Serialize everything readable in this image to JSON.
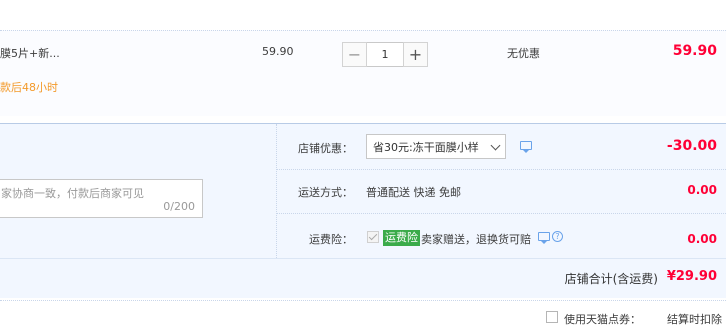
{
  "item": {
    "title_fragment": "膜5片+新...",
    "shipping_note": "款后48小时",
    "unit_price": "59.90",
    "quantity": "1",
    "qty_minus": "−",
    "qty_plus": "+",
    "promotion": "无优惠",
    "subtotal": "59.90"
  },
  "memo": {
    "placeholder": "家协商一致，付款后商家可见",
    "counter": "0/200"
  },
  "shop_discount": {
    "label": "店铺优惠：",
    "selected_option": "省30元:冻干面膜小样",
    "amount": "-30.00"
  },
  "shipping": {
    "label": "运送方式：",
    "value": "普通配送 快递 免邮",
    "amount": "0.00"
  },
  "freight_insurance": {
    "label": "运费险：",
    "badge": "运费险",
    "description": "卖家赠送，退换货可赔",
    "amount": "0.00"
  },
  "shop_total": {
    "label": "店铺合计(含运费)",
    "amount": "¥29.90"
  },
  "tmall_points": {
    "label": "使用天猫点券：",
    "note": "结算时扣除"
  },
  "colors": {
    "price_red": "#ff0036",
    "accent_orange": "#f39a2b",
    "badge_green": "#3bab4a",
    "panel_blue": "#f2f7ff",
    "link_blue": "#6aa3ea"
  },
  "icons": [
    "chat-icon",
    "help-icon",
    "chevron-down-icon",
    "check-icon"
  ]
}
